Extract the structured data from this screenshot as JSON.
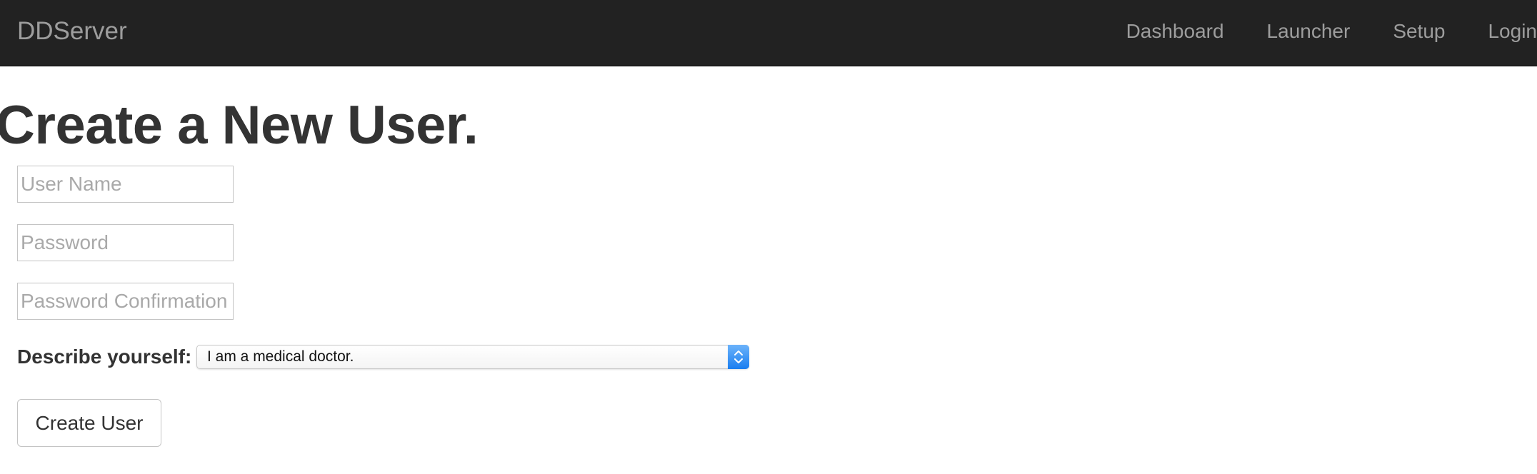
{
  "navbar": {
    "brand": "DDServer",
    "links": [
      {
        "label": "Dashboard"
      },
      {
        "label": "Launcher"
      },
      {
        "label": "Setup"
      },
      {
        "label": "Login"
      }
    ],
    "background_color": "#222222",
    "link_color": "#9d9d9d"
  },
  "main": {
    "title": "Create a New User.",
    "form": {
      "username": {
        "value": "",
        "placeholder": "User Name"
      },
      "password": {
        "value": "",
        "placeholder": "Password"
      },
      "password_confirmation": {
        "value": "",
        "placeholder": "Password Confirmation"
      },
      "describe_label": "Describe yourself:",
      "describe_select": {
        "selected": "I am a medical doctor."
      },
      "submit_label": "Create User"
    }
  },
  "icons": {
    "select_arrow": "chevron-up-down-icon"
  },
  "colors": {
    "select_accent": "#1a7ef0"
  }
}
